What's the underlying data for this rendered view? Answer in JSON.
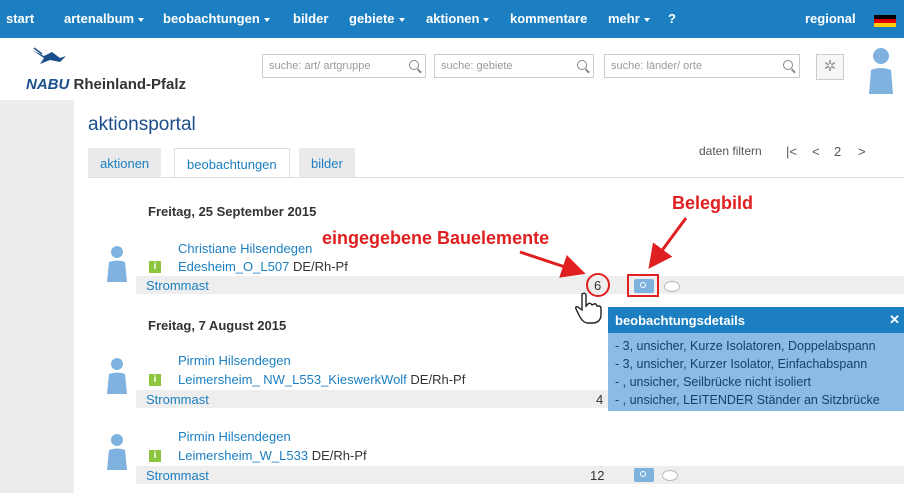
{
  "nav": {
    "items": [
      {
        "label": "start",
        "caret": false
      },
      {
        "label": "artenalbum",
        "caret": true
      },
      {
        "label": "beobachtungen",
        "caret": true
      },
      {
        "label": "bilder",
        "caret": false
      },
      {
        "label": "gebiete",
        "caret": true
      },
      {
        "label": "aktionen",
        "caret": true
      },
      {
        "label": "kommentare",
        "caret": false
      },
      {
        "label": "mehr",
        "caret": true
      },
      {
        "label": "?",
        "caret": false
      }
    ],
    "regional": "regional"
  },
  "header": {
    "logo_nabu": "NABU",
    "logo_region": "Rheinland-Pfalz",
    "search_species_placeholder": "suche: art/ artgruppe",
    "search_areas_placeholder": "suche: gebiete",
    "search_places_placeholder": "suche: länder/ orte"
  },
  "portal": {
    "title": "aktionsportal",
    "tabs": [
      "aktionen",
      "beobachtungen",
      "bilder"
    ],
    "active_tab": "beobachtungen",
    "filter_label": "daten filtern",
    "pager": {
      "first": "|<",
      "prev": "<",
      "page": "2",
      "next": ">"
    }
  },
  "groups": [
    {
      "date": "Freitag, 25 September 2015",
      "entries": [
        {
          "observer": "Christiane Hilsendegen",
          "location": "Edesheim_O_L507",
          "region": "DE/Rh-Pf",
          "category": "Strommast",
          "count": "6"
        }
      ]
    },
    {
      "date": "Freitag, 7 August 2015",
      "entries": [
        {
          "observer": "Pirmin Hilsendegen",
          "location": "Leimersheim_ NW_L553_KieswerkWolf",
          "region": "DE/Rh-Pf",
          "category": "Strommast",
          "count": "4"
        },
        {
          "observer": "Pirmin Hilsendegen",
          "location": "Leimersheim_W_L533",
          "region": "DE/Rh-Pf",
          "category": "Strommast",
          "count": "12"
        }
      ]
    }
  ],
  "popup": {
    "title": "beobachtungsdetails",
    "lines": [
      "- 3, unsicher, Kurze Isolatoren, Doppelabspann",
      "- 3, unsicher, Kurzer Isolator, Einfachabspann",
      "- , unsicher, Seilbrücke nicht isoliert",
      "- , unsicher, LEITENDER Ständer an Sitzbrücke"
    ]
  },
  "annotations": {
    "bauelemente": "eingegebene Bauelemente",
    "belegbild": "Belegbild"
  },
  "colors": {
    "nav_bg": "#1b7fc1",
    "link": "#1b7fc1",
    "annotation": "#e02020",
    "popup_bg": "#8bbbe6"
  }
}
